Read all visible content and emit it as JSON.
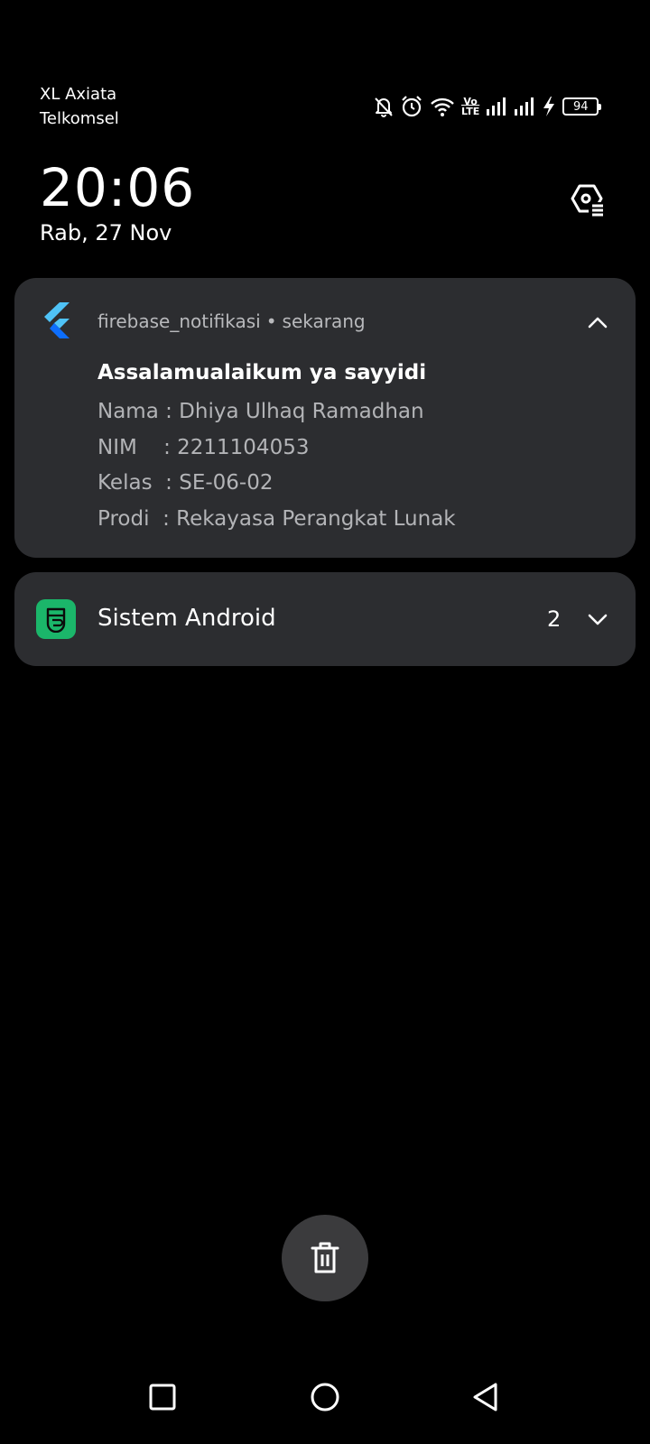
{
  "status_bar": {
    "carrier_1": "XL Axiata",
    "carrier_2": "Telkomsel",
    "volte_label_top": "Vo",
    "volte_label_bottom": "LTE",
    "battery_level": "94",
    "icons": [
      "bell-off-icon",
      "alarm-icon",
      "wifi-icon",
      "volte-icon",
      "signal-icon",
      "signal-icon",
      "charging-icon",
      "battery-icon"
    ]
  },
  "lockscreen": {
    "time": "20:06",
    "date": "Rab, 27 Nov"
  },
  "notification": {
    "app_name": "firebase_notifikasi",
    "separator": "•",
    "time": "sekarang",
    "title": "Assalamualaikum ya sayyidi",
    "lines": [
      "Nama : Dhiya Ulhaq Ramadhan",
      "NIM    : 2211104053",
      "Kelas  : SE-06-02",
      "Prodi  : Rekayasa Perangkat Lunak"
    ]
  },
  "system_group": {
    "name": "Sistem Android",
    "count": "2"
  },
  "colors": {
    "background": "#000000",
    "card": "#2c2d30",
    "secondary_text": "#b3b4b7",
    "system_icon": "#1bb66a",
    "flutter_light": "#4fc3f7",
    "flutter_dark": "#0d6efd"
  }
}
